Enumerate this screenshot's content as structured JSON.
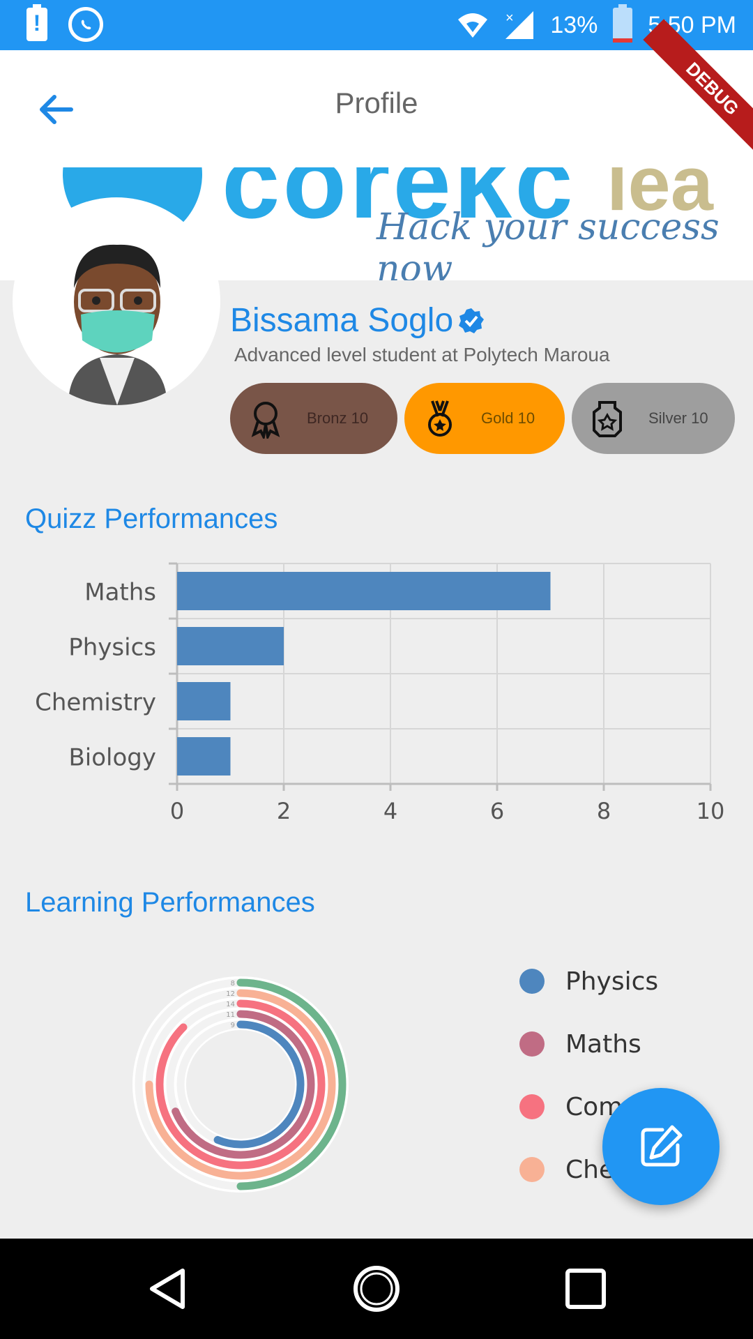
{
  "status_bar": {
    "battery_percent": "13%",
    "time": "5:50 PM",
    "alert_glyph": "!",
    "icons": [
      "battery-alert-icon",
      "whatsapp-icon",
      "wifi-icon",
      "signal-icon",
      "battery-low-icon"
    ]
  },
  "appbar": {
    "title": "Profile",
    "debug_label": "DEBUG",
    "back_icon": "arrow-left-icon"
  },
  "banner": {
    "logo_text": "corekc",
    "logo_text2": "lea",
    "tagline": "Hack your success now"
  },
  "profile": {
    "name": "Bissama Soglo",
    "verified": true,
    "subtitle": "Advanced level student at Polytech Maroua",
    "badges": [
      {
        "label": "Bronz 10",
        "icon": "ribbon-award-icon",
        "color": "#795548"
      },
      {
        "label": "Gold 10",
        "icon": "medal-icon",
        "color": "#FF9800"
      },
      {
        "label": "Silver 10",
        "icon": "trophy-icon",
        "color": "#9E9E9E"
      }
    ]
  },
  "sections": {
    "quiz_title": "Quizz Performances",
    "learning_title": "Learning Performances"
  },
  "chart_data": [
    {
      "type": "bar",
      "orientation": "horizontal",
      "categories": [
        "Maths",
        "Physics",
        "Chemistry",
        "Biology"
      ],
      "values": [
        7,
        2,
        1,
        1
      ],
      "xlim": [
        0,
        10
      ],
      "xticks": [
        0,
        2,
        4,
        6,
        8,
        10
      ],
      "grid": true,
      "color": "#4E86BE"
    },
    {
      "type": "radial-bar",
      "series": [
        {
          "name": "Physics",
          "value": 9,
          "color": "#4E86BE"
        },
        {
          "name": "Maths",
          "value": 11,
          "color": "#C06C84"
        },
        {
          "name": "Compr",
          "value": 14,
          "color": "#F67280"
        },
        {
          "name": "Che",
          "value": 12,
          "color": "#F8B195"
        },
        {
          "name": "",
          "value": 8,
          "color": "#6DB48C"
        }
      ],
      "ring_labels": [
        "8",
        "12",
        "14",
        "11",
        "9"
      ],
      "legend_position": "right"
    }
  ],
  "legend": {
    "items": [
      {
        "label": "Physics",
        "color": "#4E86BE"
      },
      {
        "label": "Maths",
        "color": "#C06C84"
      },
      {
        "label": "Compr",
        "color": "#F67280"
      },
      {
        "label": "Che",
        "color": "#F8B195"
      }
    ]
  },
  "fab": {
    "icon": "edit-icon"
  },
  "navbar": {
    "icons": [
      "back-triangle-icon",
      "home-circle-icon",
      "recents-square-icon"
    ]
  }
}
